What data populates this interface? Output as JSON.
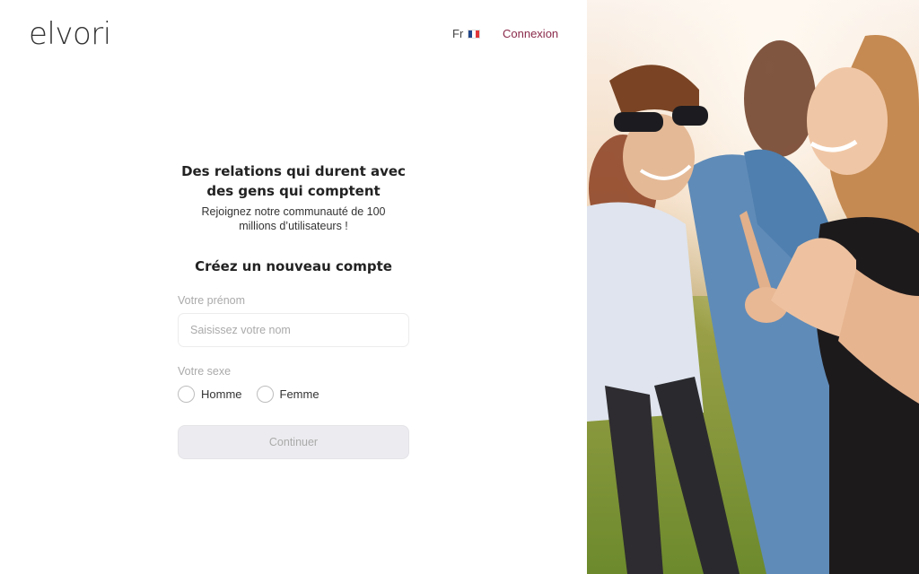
{
  "header": {
    "logo": "elvori",
    "language": "Fr",
    "login": "Connexion"
  },
  "hero": {
    "headline": "Des relations qui durent avec\ndes gens qui comptent",
    "subtitle": "Rejoignez notre communauté de 100\nmillions d’utilisateurs !"
  },
  "form": {
    "title": "Créez un nouveau compte",
    "first_name_label": "Votre prénom",
    "first_name_placeholder": "Saisissez votre nom",
    "first_name_value": "",
    "gender_label": "Votre sexe",
    "gender_options": [
      "Homme",
      "Femme"
    ],
    "continue_label": "Continuer"
  },
  "colors": {
    "login_link": "#8a2a4a",
    "flag": [
      "#21468b",
      "#ffffff",
      "#e1373a"
    ],
    "button_disabled": "#ececf0"
  },
  "icons": {
    "language_flag": "france-flag-icon"
  }
}
